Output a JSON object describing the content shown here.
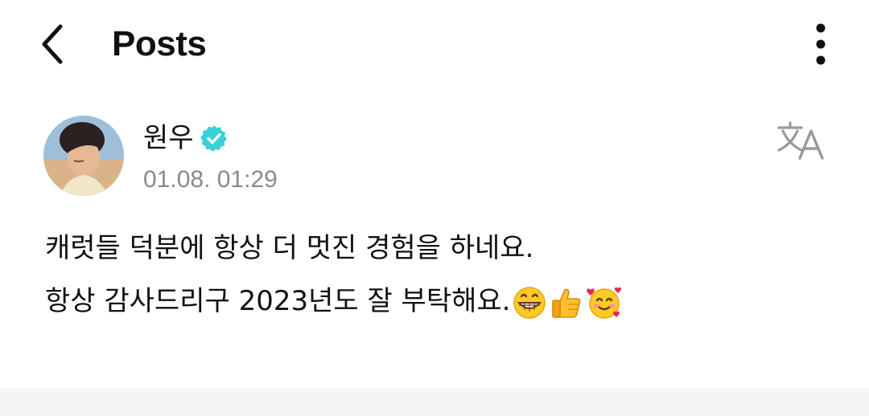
{
  "header": {
    "title": "Posts",
    "back_icon": "chevron-left-icon",
    "more_icon": "more-vertical-icon"
  },
  "post": {
    "author": {
      "name": "원우",
      "verified": true,
      "verified_color": "#39d0d8"
    },
    "timestamp": "01.08. 01:29",
    "translate_icon": "translate-icon",
    "body": {
      "line1": "캐럿들 덕분에 항상 더 멋진 경험을 하네요.",
      "line2": "항상 감사드리구 2023년도 잘 부탁해요.",
      "emojis": [
        "grinning-face-emoji",
        "thumbs-up-emoji",
        "smiling-face-with-hearts-emoji"
      ]
    }
  }
}
